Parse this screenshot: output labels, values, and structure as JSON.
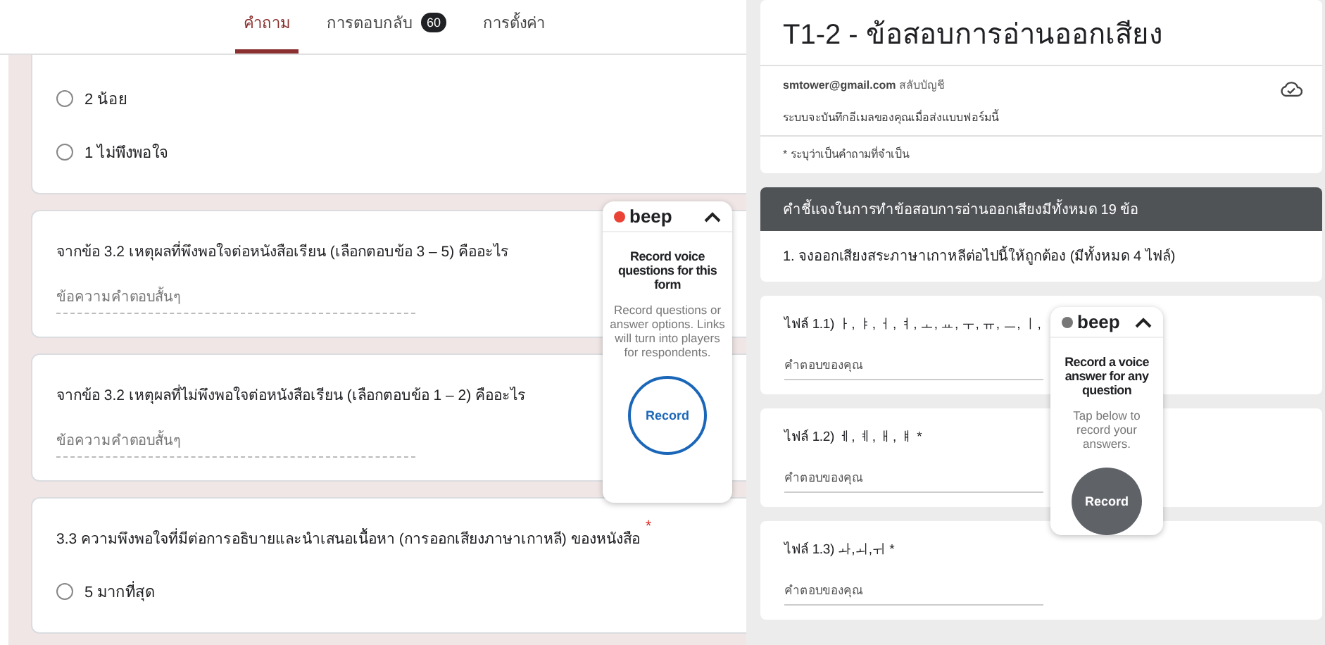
{
  "editor": {
    "tabs": [
      {
        "label": "คำถาม",
        "selected": true
      },
      {
        "label": "การตอบกลับ",
        "selected": false,
        "badge": "60"
      },
      {
        "label": "การตั้งค่า",
        "selected": false
      }
    ],
    "cards": [
      {
        "kind": "choice",
        "options": [
          {
            "label": "2 น้อย",
            "selected": false
          },
          {
            "label": "1 ไม่พึงพอใจ",
            "selected": false
          }
        ]
      },
      {
        "kind": "short",
        "question": "จากข้อ 3.2  เหตุผลที่พึงพอใจต่อหนังสือเรียน (เลือกตอบข้อ 3 – 5) คืออะไร",
        "placeholder": "ข้อความคำตอบสั้นๆ"
      },
      {
        "kind": "short",
        "question": "จากข้อ 3.2  เหตุผลที่ไม่พึงพอใจต่อหนังสือเรียน (เลือกตอบข้อ 1 – 2) คืออะไร",
        "placeholder": "ข้อความคำตอบสั้นๆ"
      },
      {
        "kind": "choice",
        "question": "3.3 ความพึงพอใจที่มีต่อการอธิบายและนำเสนอเนื้อหา (การออกเสียงภาษาเกาหลี) ของหนังสือ",
        "required_mark": "*",
        "options": [
          {
            "label": "5 มากที่สุด",
            "selected": false
          }
        ]
      }
    ],
    "beep": {
      "brand": "beep",
      "color": "#ea4335",
      "title": "Record voice questions for this form",
      "description": "Record questions or answer options. Links will turn into players for respondents.",
      "button": "Record",
      "filled": false
    }
  },
  "form": {
    "title": "T1-2 - ข้อสอบการอ่านออกเสียง",
    "email": "smtower@gmail.com",
    "switch_account": "สลับบัญชี",
    "email_note": "ระบบจะบันทึกอีเมลของคุณเมื่อส่งแบบฟอร์มนี้",
    "required_note": "* ระบุว่าเป็นคำถามที่จำเป็น",
    "section": {
      "title": "คำชี้แจงในการทำข้อสอบการอ่านออกเสียงมีทั้งหมด 19 ข้อ",
      "description": "1. จงออกเสียงสระภาษาเกาหลีต่อไปนี้ให้ถูกต้อง (มีทั้งหมด 4 ไฟล์)"
    },
    "questions": [
      {
        "question": "ไฟล์ 1.1) ㅏ, ㅑ, ㅓ, ㅕ, ㅗ, ㅛ, ㅜ, ㅠ, ㅡ, ㅣ,",
        "placeholder": "คำตอบของคุณ"
      },
      {
        "question": "ไฟล์ 1.2) ㅔ, ㅖ, ㅐ, ㅒ *",
        "placeholder": "คำตอบของคุณ"
      },
      {
        "question": "ไฟล์ 1.3) ㅘ,ㅚ,ㅟ  *",
        "placeholder": "คำตอบของคุณ"
      }
    ],
    "beep": {
      "brand": "beep",
      "color": "#777777",
      "title": "Record a voice answer for any question",
      "description": "Tap below to record your answers.",
      "button": "Record",
      "filled": true
    }
  }
}
